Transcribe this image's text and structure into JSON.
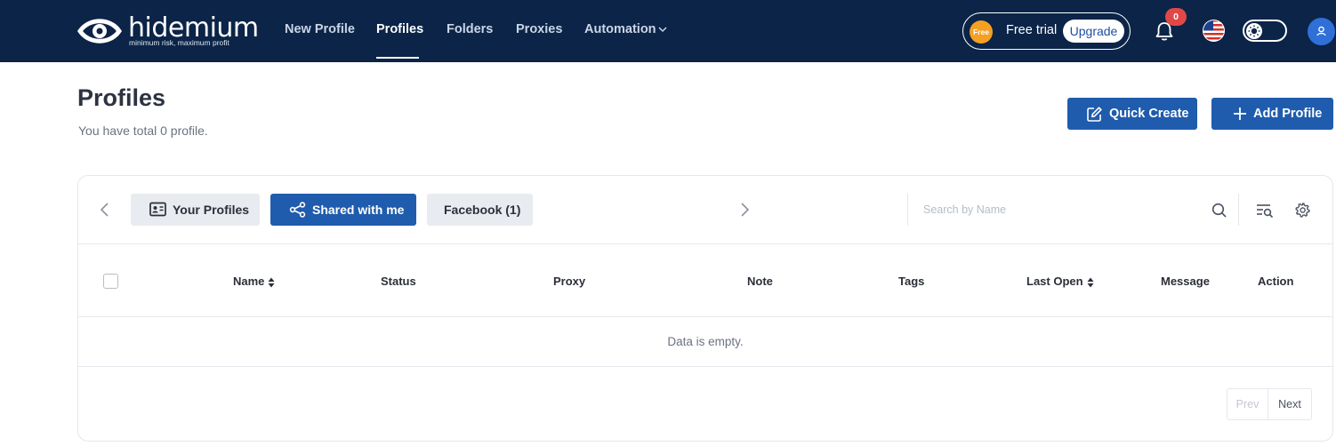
{
  "brand": {
    "name": "hidemium",
    "tagline": "minimum risk, maximum profit"
  },
  "nav": {
    "items": [
      {
        "label": "New Profile"
      },
      {
        "label": "Profiles",
        "active": true
      },
      {
        "label": "Folders"
      },
      {
        "label": "Proxies"
      },
      {
        "label": "Automation"
      }
    ]
  },
  "header": {
    "free_badge": "Free",
    "trial_text": "Free trial",
    "upgrade_label": "Upgrade",
    "notification_count": "0",
    "language_icon": "us-flag-icon",
    "theme_icon": "sun-icon",
    "avatar_icon": "user-icon"
  },
  "page": {
    "title": "Profiles",
    "subtitle": "You have total 0 profile.",
    "quick_create_label": "Quick Create",
    "add_profile_label": "Add Profile"
  },
  "tabs": [
    {
      "label": "Your Profiles",
      "icon": "id-card-icon"
    },
    {
      "label": "Shared with me",
      "icon": "share-icon",
      "active": true
    },
    {
      "label": "Facebook (1)"
    }
  ],
  "search": {
    "placeholder": "Search by Name",
    "value": ""
  },
  "table": {
    "columns": [
      "Name",
      "Status",
      "Proxy",
      "Note",
      "Tags",
      "Last Open",
      "Message",
      "Action"
    ],
    "sortable": [
      "Name",
      "Last Open"
    ],
    "rows": [],
    "empty_text": "Data is empty."
  },
  "pagination": {
    "prev_label": "Prev",
    "next_label": "Next"
  },
  "colors": {
    "header_bg": "#0b2447",
    "primary": "#1f5cad",
    "badge_red": "#e04848",
    "free_orange": "#f5a023"
  }
}
